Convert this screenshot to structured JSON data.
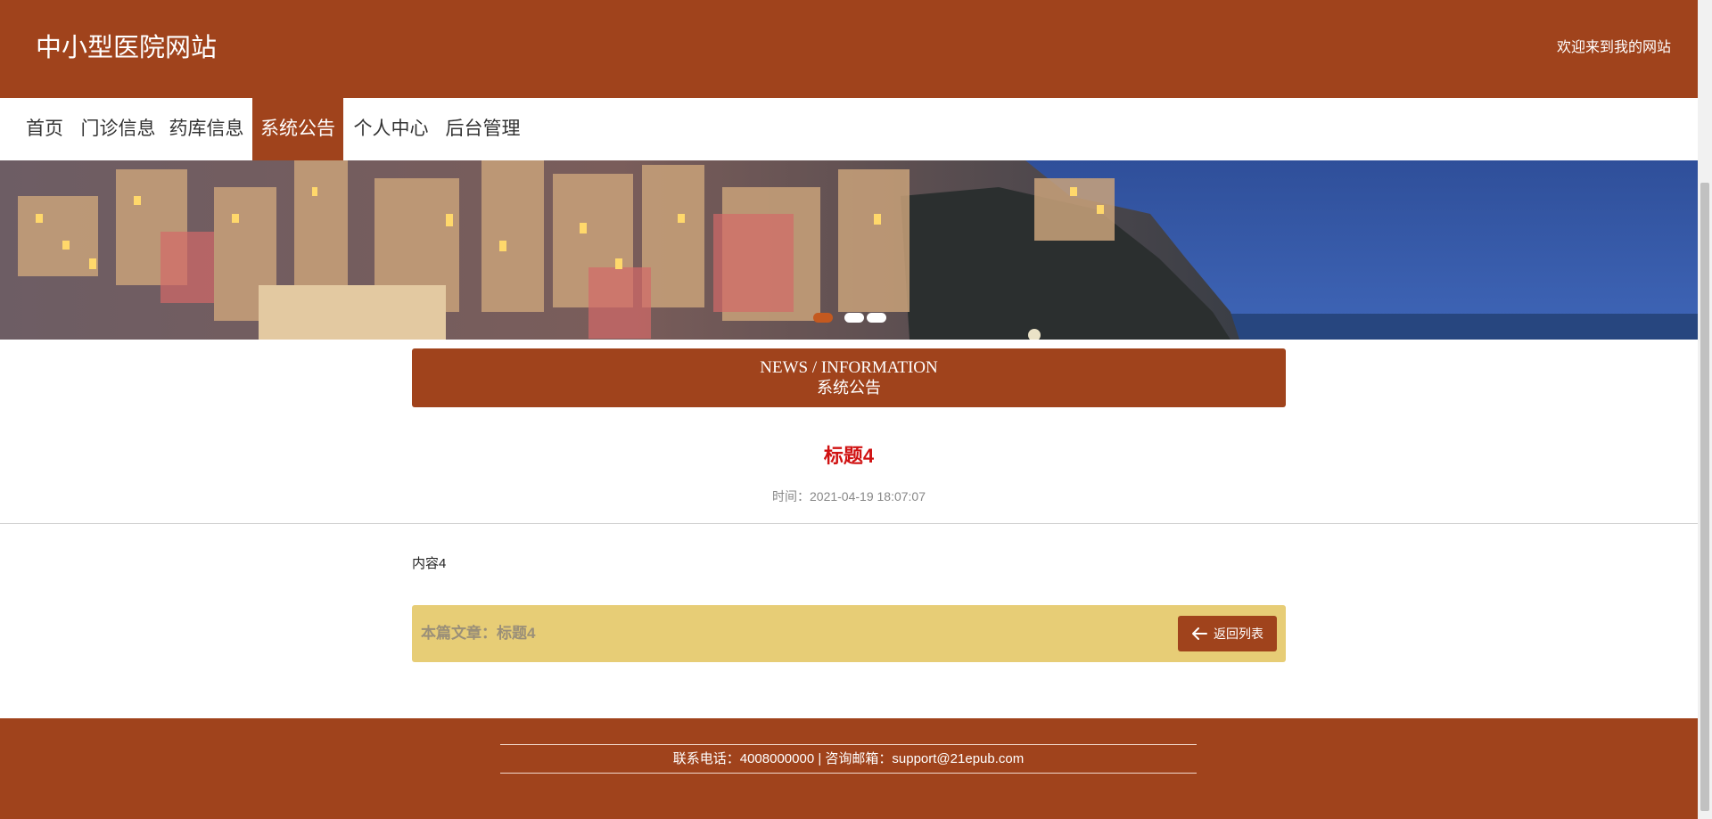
{
  "header": {
    "site_title": "中小型医院网站",
    "welcome": "欢迎来到我的网站"
  },
  "nav": {
    "items": [
      {
        "label": "首页"
      },
      {
        "label": "门诊信息"
      },
      {
        "label": "药库信息"
      },
      {
        "label": "系统公告",
        "active": true
      },
      {
        "label": "个人中心"
      },
      {
        "label": "后台管理"
      }
    ]
  },
  "banner": {
    "slide_count": 3,
    "active_slide": 1
  },
  "section": {
    "title_en": "NEWS / INFORMATION",
    "title_cn": "系统公告"
  },
  "article": {
    "title": "标题4",
    "time_label": "时间：",
    "time_value": "2021-04-19 18:07:07",
    "content": "内容4"
  },
  "current_article": {
    "text": "本篇文章：标题4",
    "back_label": "返回列表",
    "back_icon": "arrow-left-icon"
  },
  "footer": {
    "contact": "联系电话：4008000000 | 咨询邮箱：support@21epub.com"
  },
  "colors": {
    "brand": "#a0431c",
    "title_red": "#d01212",
    "highlight_bar": "#e7cd76"
  }
}
